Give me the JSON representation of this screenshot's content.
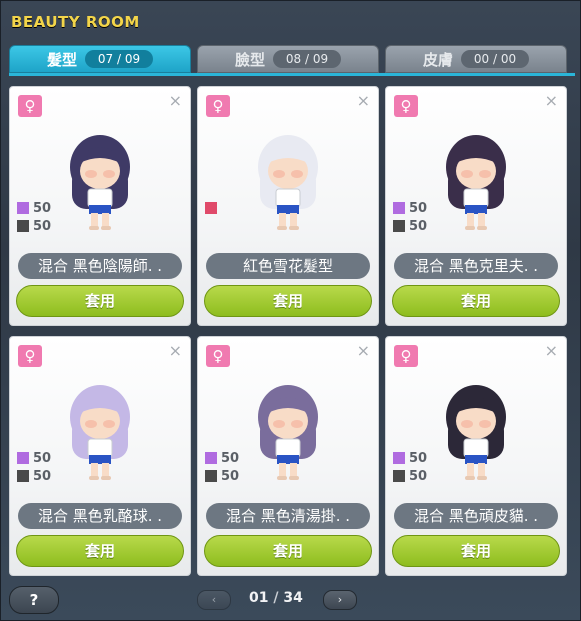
{
  "window": {
    "title": "BEAUTY ROOM"
  },
  "tabs": [
    {
      "label": "髮型",
      "count": "07 / 09",
      "active": true
    },
    {
      "label": "臉型",
      "count": "08 / 09",
      "active": false
    },
    {
      "label": "皮膚",
      "count": "00 / 00",
      "active": false
    }
  ],
  "cards": [
    {
      "name": "混合  黑色陰陽師. .",
      "button": "套用",
      "gender": "♀",
      "swatches": [
        {
          "color": "#b06be0",
          "pct": "50"
        },
        {
          "color": "#4a4a4a",
          "pct": "50"
        }
      ],
      "hair_color": "#3f3a66"
    },
    {
      "name": "紅色雪花髮型",
      "button": "套用",
      "gender": "♀",
      "swatches": [
        {
          "color": "#e04a6a",
          "pct": ""
        }
      ],
      "hair_color": "#e8eaf2"
    },
    {
      "name": "混合  黑色克里夫. .",
      "button": "套用",
      "gender": "♀",
      "swatches": [
        {
          "color": "#b06be0",
          "pct": "50"
        },
        {
          "color": "#4a4a4a",
          "pct": "50"
        }
      ],
      "hair_color": "#3a2e4a"
    },
    {
      "name": "混合  黑色乳酪球. .",
      "button": "套用",
      "gender": "♀",
      "swatches": [
        {
          "color": "#b06be0",
          "pct": "50"
        },
        {
          "color": "#4a4a4a",
          "pct": "50"
        }
      ],
      "hair_color": "#c4b8e6"
    },
    {
      "name": "混合  黑色清湯掛. .",
      "button": "套用",
      "gender": "♀",
      "swatches": [
        {
          "color": "#b06be0",
          "pct": "50"
        },
        {
          "color": "#4a4a4a",
          "pct": "50"
        }
      ],
      "hair_color": "#7a6d9c"
    },
    {
      "name": "混合  黑色頑皮貓. .",
      "button": "套用",
      "gender": "♀",
      "swatches": [
        {
          "color": "#b06be0",
          "pct": "50"
        },
        {
          "color": "#4a4a4a",
          "pct": "50"
        }
      ],
      "hair_color": "#2c2838"
    }
  ],
  "pagination": {
    "current": "01",
    "separator": "/",
    "total": "34",
    "prev_icon": "‹",
    "next_icon": "›"
  },
  "help": {
    "label": "?"
  },
  "icons": {
    "close": "×"
  }
}
